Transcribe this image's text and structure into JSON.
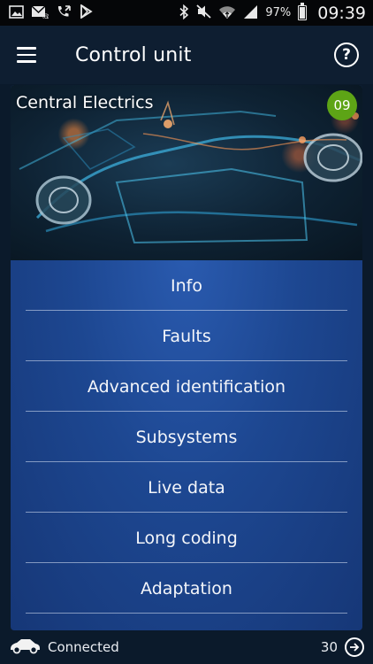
{
  "status_bar": {
    "left_icons": [
      "gallery-icon",
      "mail-icon",
      "phone-icon",
      "play-store-icon"
    ],
    "right_icons": [
      "bluetooth-icon",
      "mute-icon",
      "wifi-icon",
      "signal-icon"
    ],
    "battery_percent": "97%",
    "battery_level": 0.97,
    "time": "09:39"
  },
  "app_bar": {
    "title": "Control unit",
    "menu_icon": "hamburger-menu-icon",
    "help_icon": "help-icon",
    "help_glyph": "?"
  },
  "card": {
    "title": "Central Electrics",
    "badge": "09",
    "badge_color": "#5da416",
    "items": [
      {
        "label": "Info"
      },
      {
        "label": "Faults"
      },
      {
        "label": "Advanced identification"
      },
      {
        "label": "Subsystems"
      },
      {
        "label": "Live data"
      },
      {
        "label": "Long coding"
      },
      {
        "label": "Adaptation"
      }
    ]
  },
  "bottom_bar": {
    "status": "Connected",
    "count": "30",
    "car_icon": "car-icon",
    "exit_icon": "exit-icon"
  },
  "colors": {
    "accent_blue": "#1d4791",
    "background": "#0b1a2b"
  }
}
